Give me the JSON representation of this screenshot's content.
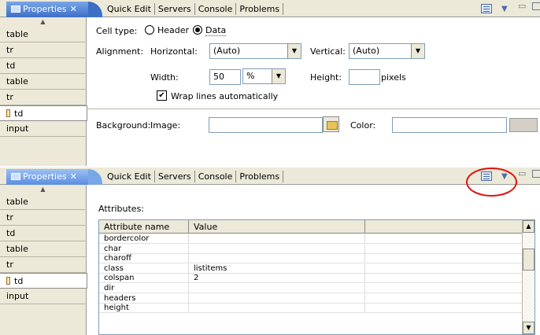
{
  "tabs": {
    "properties": "Properties",
    "close": "✕",
    "quick_edit": "Quick Edit",
    "servers": "Servers",
    "console": "Console",
    "problems": "Problems"
  },
  "view_controls": {
    "dropdown": "▼",
    "minimize": "▭",
    "scroll_up": "▲",
    "scroll_down": "▼"
  },
  "sidebar": {
    "items": [
      "table",
      "tr",
      "td",
      "table",
      "tr",
      "td",
      "input"
    ]
  },
  "cell": {
    "type_label": "Cell type:",
    "header_label": "Header",
    "data_label": "Data",
    "selected": "Data",
    "alignment_label": "Alignment:",
    "horizontal_label": "Horizontal:",
    "horizontal_value": "(Auto)",
    "vertical_label": "Vertical:",
    "vertical_value": "(Auto)",
    "width_label": "Width:",
    "width_value": "50",
    "width_unit": "%",
    "height_label": "Height:",
    "height_value": "",
    "height_unit": "pixels",
    "wrap_label": "Wrap lines automatically",
    "wrap_checked": true,
    "wrap_mark": "✔",
    "background_label": "Background:",
    "image_label": "Image:",
    "image_value": "",
    "color_label": "Color:",
    "color_value": ""
  },
  "attributes": {
    "title": "Attributes:",
    "col_name": "Attribute name",
    "col_value": "Value",
    "rows": [
      {
        "name": "bordercolor",
        "value": ""
      },
      {
        "name": "char",
        "value": ""
      },
      {
        "name": "charoff",
        "value": ""
      },
      {
        "name": "class",
        "value": "listitems"
      },
      {
        "name": "colspan",
        "value": "2"
      },
      {
        "name": "dir",
        "value": ""
      },
      {
        "name": "headers",
        "value": ""
      },
      {
        "name": "height",
        "value": ""
      }
    ]
  },
  "colors": {
    "tab_active": "#3d6fc7",
    "panel_bg": "#ece9d8",
    "annotation_ring": "#e01010"
  }
}
